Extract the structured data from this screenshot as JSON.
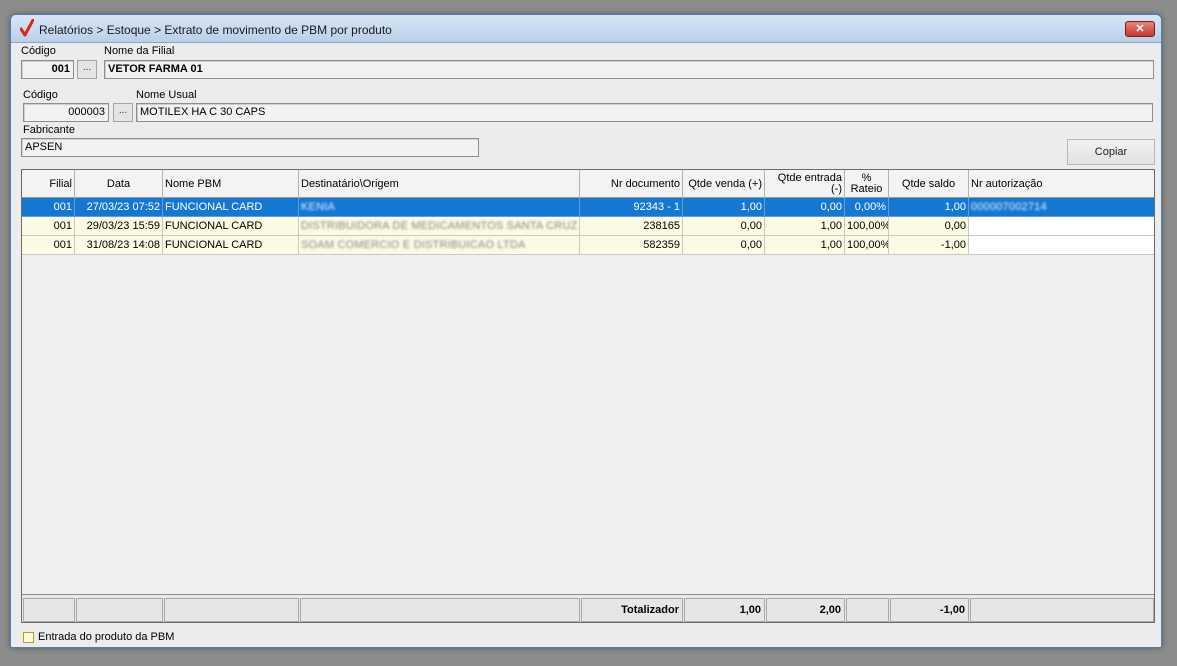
{
  "window": {
    "title": "Relatórios > Estoque > Extrato de movimento de PBM por produto",
    "close_label": "✕"
  },
  "filial": {
    "codigo_label": "Código",
    "codigo_value": "001",
    "nome_label": "Nome da Filial",
    "nome_value": "VETOR FARMA 01",
    "lookup_label": "..."
  },
  "produto": {
    "codigo_label": "Código",
    "codigo_value": "000003",
    "nome_label": "Nome Usual",
    "nome_value": "MOTILEX HA C 30 CAPS",
    "lookup_label": "..."
  },
  "fabricante": {
    "label": "Fabricante",
    "value": "APSEN"
  },
  "copy_button": "Copiar",
  "grid": {
    "columns": [
      "Filial",
      "Data",
      "Nome PBM",
      "Destinatário\\Origem",
      "Nr documento",
      "Qtde venda (+)",
      "Qtde entrada (-)",
      "% Rateio",
      "Qtde saldo",
      "Nr autorização"
    ],
    "rows": [
      {
        "filial": "001",
        "data": "27/03/23 07:52",
        "nome_pbm": "FUNCIONAL CARD",
        "destinatario": "KENIA",
        "nr_documento": "92343 - 1",
        "qtde_venda": "1,00",
        "qtde_entrada": "0,00",
        "rateio": "0,00%",
        "qtde_saldo": "1,00",
        "nr_autorizacao": "000007002714",
        "selected": true
      },
      {
        "filial": "001",
        "data": "29/03/23 15:59",
        "nome_pbm": "FUNCIONAL CARD",
        "destinatario": "DISTRIBUIDORA DE MEDICAMENTOS SANTA CRUZ LT",
        "nr_documento": "238165",
        "qtde_venda": "0,00",
        "qtde_entrada": "1,00",
        "rateio": "100,00%",
        "qtde_saldo": "0,00",
        "nr_autorizacao": "",
        "selected": false
      },
      {
        "filial": "001",
        "data": "31/08/23 14:08",
        "nome_pbm": "FUNCIONAL CARD",
        "destinatario": "SOAM COMERCIO E DISTRIBUICAO LTDA",
        "nr_documento": "582359",
        "qtde_venda": "0,00",
        "qtde_entrada": "1,00",
        "rateio": "100,00%",
        "qtde_saldo": "-1,00",
        "nr_autorizacao": "",
        "selected": false
      }
    ],
    "totals": {
      "label": "Totalizador",
      "qtde_venda": "1,00",
      "qtde_entrada": "2,00",
      "qtde_saldo": "-1,00"
    }
  },
  "checkbox": {
    "label": "Entrada do produto da PBM",
    "checked": false
  },
  "colors": {
    "selected_row": "#1478d2",
    "row_background": "#fbfae2",
    "window_background": "#ececec"
  }
}
